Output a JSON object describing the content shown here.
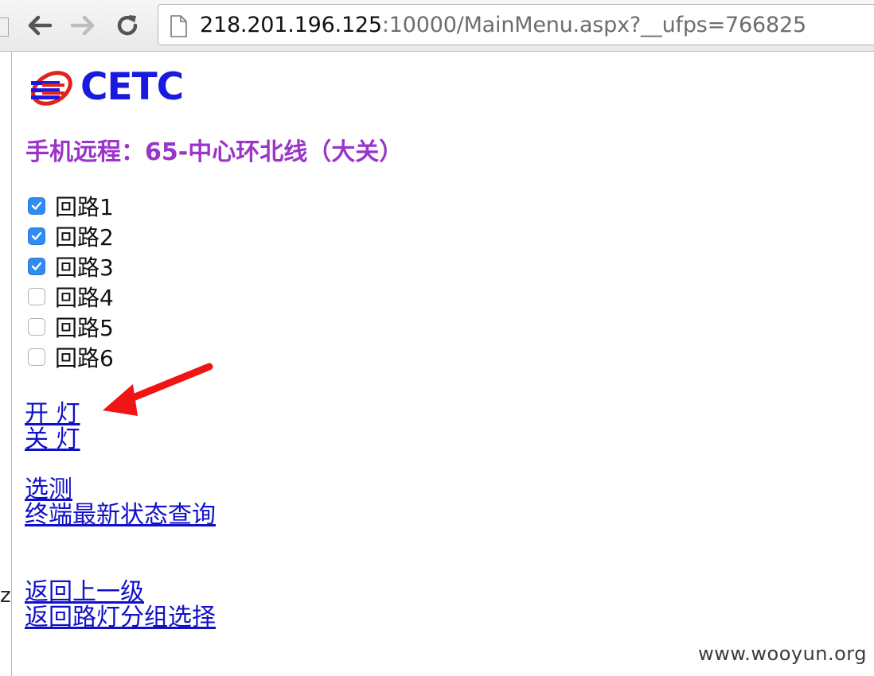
{
  "browser": {
    "url_host": "218.201.196.125",
    "url_rest": ":10000/MainMenu.aspx?__ufps=766825",
    "back_icon": "back-arrow-icon",
    "forward_icon": "forward-arrow-icon",
    "reload_icon": "reload-icon"
  },
  "logo": {
    "text": "CETC"
  },
  "page": {
    "title": "手机远程：65-中心环北线（大关）",
    "title_color": "#9a35c9",
    "loops": [
      {
        "label": "回路1",
        "checked": true
      },
      {
        "label": "回路2",
        "checked": true
      },
      {
        "label": "回路3",
        "checked": true
      },
      {
        "label": "回路4",
        "checked": false
      },
      {
        "label": "回路5",
        "checked": false
      },
      {
        "label": "回路6",
        "checked": false
      }
    ],
    "actions": {
      "light_on": "开 灯",
      "light_off": "关 灯"
    },
    "menu": {
      "select_measure": "选测",
      "terminal_status": "终端最新状态查询"
    },
    "nav": {
      "back_level": "返回上一级",
      "back_groups": "返回路灯分组选择"
    },
    "link_color": "#1010c8"
  },
  "watermark": "www.wooyun.org",
  "edge_glyph": "z"
}
